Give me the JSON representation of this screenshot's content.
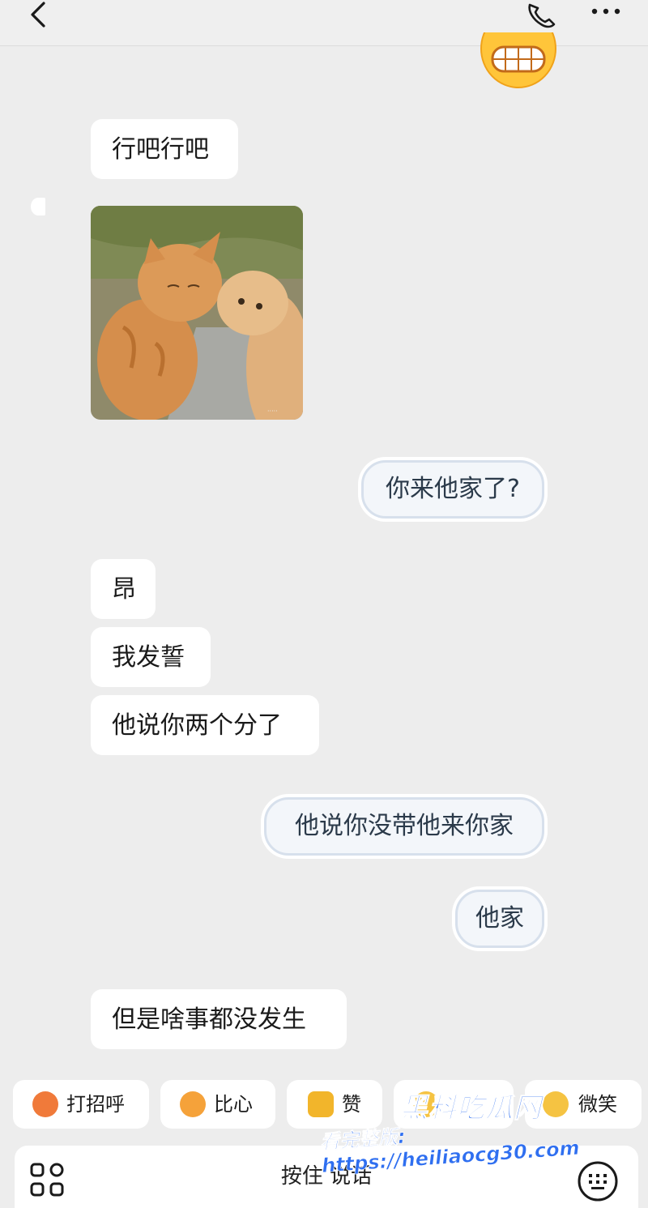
{
  "header": {
    "back_icon": "chevron-left-icon",
    "call_icon": "phone-icon",
    "more_icon": "more-horizontal-icon"
  },
  "messages": [
    {
      "side": "left",
      "type": "text",
      "text": "行吧行吧"
    },
    {
      "side": "left",
      "type": "image",
      "image": "two-orange-cats-photo"
    },
    {
      "side": "right",
      "type": "sticker-text",
      "text": "你来他家了?"
    },
    {
      "side": "left",
      "type": "text",
      "text": "昂"
    },
    {
      "side": "left",
      "type": "text",
      "text": "我发誓"
    },
    {
      "side": "left",
      "type": "text",
      "text": "他说你两个分了"
    },
    {
      "side": "right",
      "type": "sticker-text",
      "text": "他说你没带他来你家"
    },
    {
      "side": "right",
      "type": "sticker-text",
      "text": "他家"
    },
    {
      "side": "left",
      "type": "text",
      "text": "但是啥事都没发生"
    }
  ],
  "quick_replies": [
    {
      "label": "打招呼",
      "icon": "wave-emoji-icon"
    },
    {
      "label": "比心",
      "icon": "heart-hands-emoji-icon"
    },
    {
      "label": "赞",
      "icon": "thumbs-up-icon"
    },
    {
      "label": "",
      "icon": "emoji-icon"
    },
    {
      "label": "微笑",
      "icon": "smile-emoji-icon"
    }
  ],
  "input": {
    "hold_to_talk": "按住 说话",
    "apps_icon": "apps-grid-icon",
    "keyboard_icon": "keyboard-icon"
  },
  "watermark": {
    "site": "黑料吃瓜网",
    "url": "看完整版: https://heiliaocg30.com"
  },
  "colors": {
    "background": "#ededed",
    "bubble": "#ffffff",
    "sticker_border": "#d7e0ec",
    "watermark": "#2f6ff0"
  }
}
